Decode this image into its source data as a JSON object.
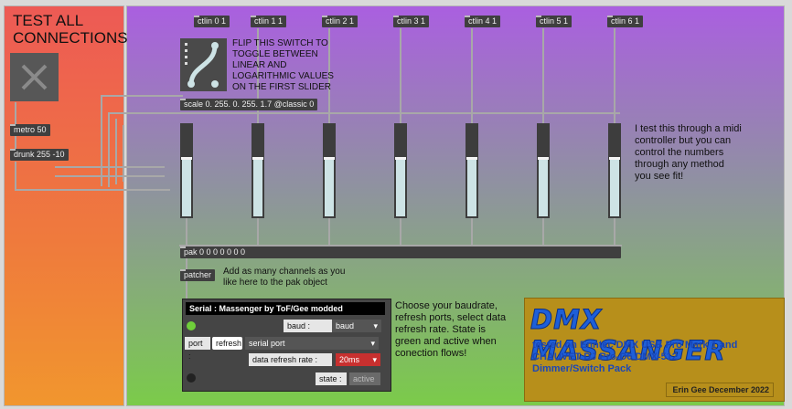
{
  "left_panel": {
    "title": "TEST ALL CONNECTIONS",
    "metro": "metro 50",
    "drunk": "drunk 255 -10",
    "bang_icon": "x-icon"
  },
  "ctlin": [
    "ctlin 0 1",
    "ctlin 1 1",
    "ctlin 2 1",
    "ctlin 3 1",
    "ctlin 4 1",
    "ctlin 5 1",
    "ctlin 6 1"
  ],
  "sliders": [
    0.65,
    0.65,
    0.65,
    0.65,
    0.65,
    0.65,
    0.65
  ],
  "switch_comment": "FLIP THIS SWITCH TO TOGGLE BETWEEN LINEAR AND LOGARITHMIC VALUES ON THE FIRST SLIDER",
  "scale_obj": "scale 0. 255. 0. 255. 1.7 @classic 0",
  "note_midi": "I test this through a midi controller but you can control the numbers through any method you see fit!",
  "pak_obj": "pak 0 0 0 0 0 0 0",
  "patcher": "patcher",
  "note_pak": "Add as many channels as you like here to the pak object",
  "serial": {
    "title": "Serial : Massenger by ToF/Gee modded",
    "baud_label": "baud :",
    "baud_value": "baud",
    "port_label": "port :",
    "refresh_button": "refresh",
    "port_value": "serial port",
    "rate_label": "data refresh rate :",
    "rate_value": "20ms",
    "state_label": "state :",
    "state_value": "active",
    "colors": {
      "rate_bg": "#c8302f",
      "led_on": "#6fcf3a",
      "led_off": "#222222"
    }
  },
  "note_baud": "Choose your baudrate, refresh ports, select data refresh rate. State is green and active when conection flows!",
  "logo": {
    "title": "DMX MASSANGER",
    "tested": "tested on Enntec DMX USB Pro Mark 1 and CHAUVET DJ Pro-D6 DMX-512 Dimmer/Switch Pack",
    "credit": "Erin Gee December 2022"
  }
}
